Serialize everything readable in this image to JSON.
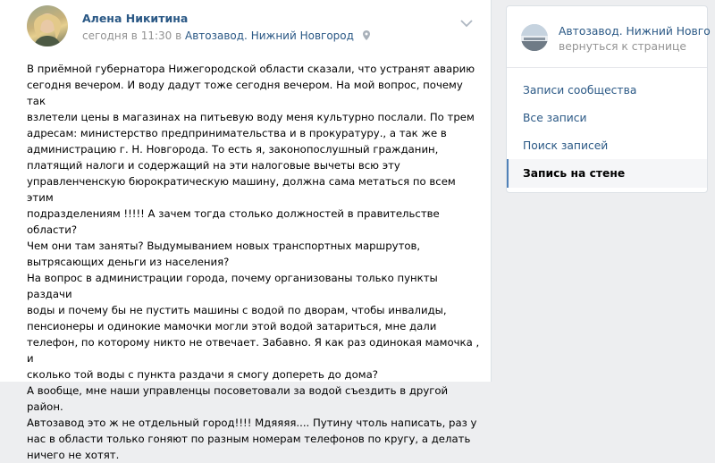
{
  "post": {
    "author": "Алена Никитина",
    "time": "сегодня в 11:30 в",
    "location": "Автозавод. Нижний Новгород",
    "text": "В приёмной губернатора Нижегородской области сказали, что устранят аварию\nсегодня вечером. И воду дадут тоже сегодня вечером. На мой вопрос, почему так\nвзлетели цены в магазинах на питьевую воду меня культурно послали. По трем\nадресам: министерство предпринимательства и в прокуратуру., а так же в\nадминистрацию г. Н. Новгорода. То есть я, законопослушный гражданин,\nплатящий налоги и содержащий на эти налоговые вычеты всю эту\nуправленченскую бюрократическую машину, должна сама метаться по всем этим\nподразделениям !!!!! А зачем тогда столько должностей в правительстве области?\nЧем они там заняты? Выдумыванием новых транспортных маршрутов,\nвытрясающих деньги из населения?\nНа вопрос в администрации города, почему организованы только пункты раздачи\nводы и почему бы не пустить машины с водой по дворам, чтобы инвалиды,\nпенсионеры и одинокие мамочки могли этой водой затариться, мне дали\nтелефон, по которому никто не отвечает. Забавно. Я как раз одинокая мамочка , и\nсколько той воды с пункта раздачи я смогу допереть до дома?\nА вообще, мне наши управленцы посоветовали за водой съездить в другой район.\nАвтозавод это ж не отдельный город!!!! Мдяяяя.... Путину чтоль написать, раз у\nнас в области только гоняют по разным номерам телефонов по кругу, а делать\nничего не хотят."
  },
  "sidebar": {
    "group_name": "Автозавод. Нижний Новго",
    "back_label": "вернуться к странице",
    "menu": [
      {
        "label": "Записи сообщества",
        "active": false
      },
      {
        "label": "Все записи",
        "active": false
      },
      {
        "label": "Поиск записей",
        "active": false
      },
      {
        "label": "Запись на стене",
        "active": true
      }
    ]
  },
  "colors": {
    "link": "#2a5885",
    "muted": "#939393",
    "accent": "#5181b8",
    "background": "#edeef0"
  },
  "icons": {
    "author_avatar": "avatar",
    "group_avatar": "group-avatar",
    "location_pin": "map-pin-icon",
    "post_menu": "chevron-down-icon"
  }
}
